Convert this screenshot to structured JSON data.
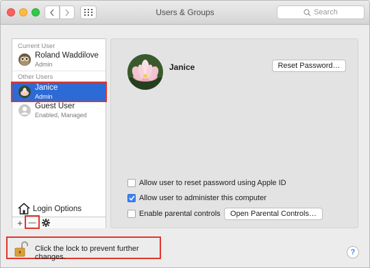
{
  "window": {
    "title": "Users & Groups"
  },
  "toolbar": {
    "search_placeholder": "Search",
    "back_icon": "chevron-left-icon",
    "forward_icon": "chevron-right-icon",
    "grid_icon": "grid-icon"
  },
  "sidebar": {
    "current_user_label": "Current User",
    "other_users_label": "Other Users",
    "current_user": {
      "name": "Roland Waddilove",
      "role": "Admin"
    },
    "other_users": [
      {
        "name": "Janice",
        "role": "Admin"
      },
      {
        "name": "Guest User",
        "role": "Enabled, Managed"
      }
    ],
    "login_options": "Login Options",
    "add_label": "+",
    "remove_label": "—",
    "gear_icon": "gear-icon"
  },
  "detail": {
    "user_name": "Janice",
    "reset_password_button": "Reset Password…",
    "options": [
      {
        "label": "Allow user to reset password using Apple ID",
        "checked": false
      },
      {
        "label": "Allow user to administer this computer",
        "checked": true
      },
      {
        "label": "Enable parental controls",
        "checked": false
      }
    ],
    "parental_controls_button": "Open Parental Controls…"
  },
  "footer": {
    "lock_text": "Click the lock to prevent further changes.",
    "help_label": "?"
  },
  "colors": {
    "selection": "#2c6ad6",
    "highlight_outline": "#e0332b",
    "checkbox_checked": "#3b82f6"
  }
}
